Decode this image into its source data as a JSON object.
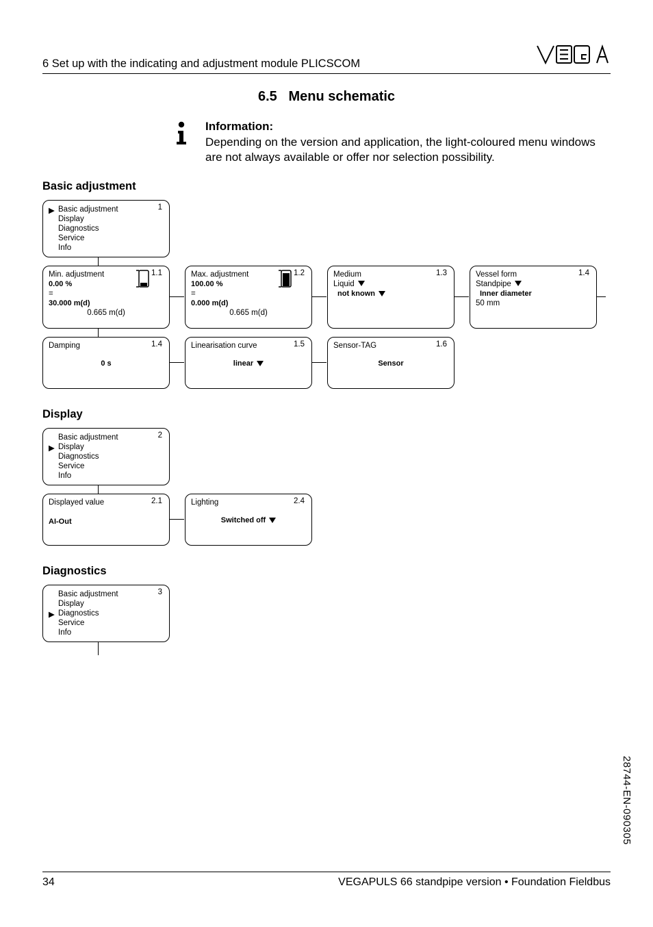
{
  "header": {
    "chapter": "6   Set up with the indicating and adjustment module PLICSCOM",
    "logo_text": "VEGA"
  },
  "section": {
    "number": "6.5",
    "title": "Menu schematic"
  },
  "info": {
    "title": "Information:",
    "body": "Depending on the version and application, the light-coloured menu windows are not always available or offer nor selection possibility."
  },
  "basic_adjustment": {
    "heading": "Basic adjustment",
    "root": {
      "index": "1",
      "items": [
        "Basic adjustment",
        "Display",
        "Diagnostics",
        "Service",
        "Info"
      ],
      "selected": 0
    },
    "min": {
      "index": "1.1",
      "title": "Min. adjustment",
      "pct": "0.00 %",
      "eq": "=",
      "val": "30.000 m(d)",
      "sub": "0.665 m(d)"
    },
    "max": {
      "index": "1.2",
      "title": "Max. adjustment",
      "pct": "100.00 %",
      "eq": "=",
      "val": "0.000 m(d)",
      "sub": "0.665 m(d)"
    },
    "medium": {
      "index": "1.3",
      "title": "Medium",
      "l1": "Liquid",
      "l2": "not known"
    },
    "vessel": {
      "index": "1.4",
      "title": "Vessel form",
      "l1": "Standpipe",
      "l2": "Inner diameter",
      "l3": "50 mm"
    },
    "damping": {
      "index": "1.4",
      "title": "Damping",
      "val": "0 s"
    },
    "lin": {
      "index": "1.5",
      "title": "Linearisation curve",
      "val": "linear"
    },
    "tag": {
      "index": "1.6",
      "title": "Sensor-TAG",
      "val": "Sensor"
    }
  },
  "display": {
    "heading": "Display",
    "root": {
      "index": "2",
      "items": [
        "Basic adjustment",
        "Display",
        "Diagnostics",
        "Service",
        "Info"
      ],
      "selected": 1
    },
    "disp_val": {
      "index": "2.1",
      "title": "Displayed value",
      "val": "AI-Out"
    },
    "lighting": {
      "index": "2.4",
      "title": "Lighting",
      "val": "Switched off"
    }
  },
  "diagnostics": {
    "heading": "Diagnostics",
    "root": {
      "index": "3",
      "items": [
        "Basic adjustment",
        "Display",
        "Diagnostics",
        "Service",
        "Info"
      ],
      "selected": 2
    }
  },
  "footer": {
    "page": "34",
    "product": "VEGAPULS 66 standpipe version • Foundation Fieldbus",
    "doc_id": "28744-EN-090305"
  }
}
